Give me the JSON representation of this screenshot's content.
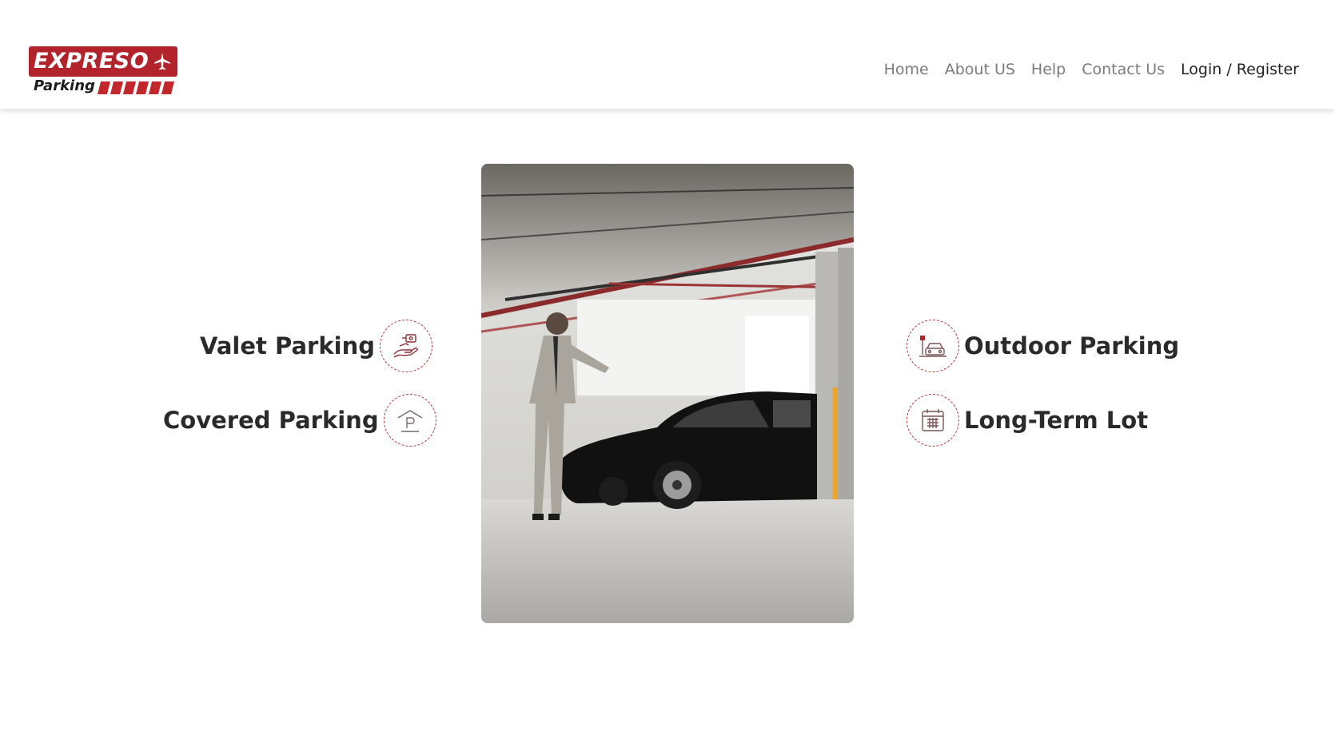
{
  "logo": {
    "top_text": "EXPRESO",
    "bottom_text": "Parking"
  },
  "nav": {
    "items": [
      "Home",
      "About US",
      "Help",
      "Contact Us",
      "Login / Register"
    ]
  },
  "hero_image": {
    "icon": "valet-man-with-car-photo"
  },
  "features": {
    "left": [
      {
        "label": "Valet Parking",
        "icon": "valet-hand-key-icon"
      },
      {
        "label": "Covered Parking",
        "icon": "covered-parking-p-icon"
      }
    ],
    "right": [
      {
        "label": "Outdoor Parking",
        "icon": "outdoor-car-icon"
      },
      {
        "label": "Long-Term Lot",
        "icon": "calendar-icon"
      }
    ]
  },
  "colors": {
    "brand_red": "#b3232b",
    "text_dark": "#2a2a2a",
    "nav_grey": "#7b7b7b"
  }
}
